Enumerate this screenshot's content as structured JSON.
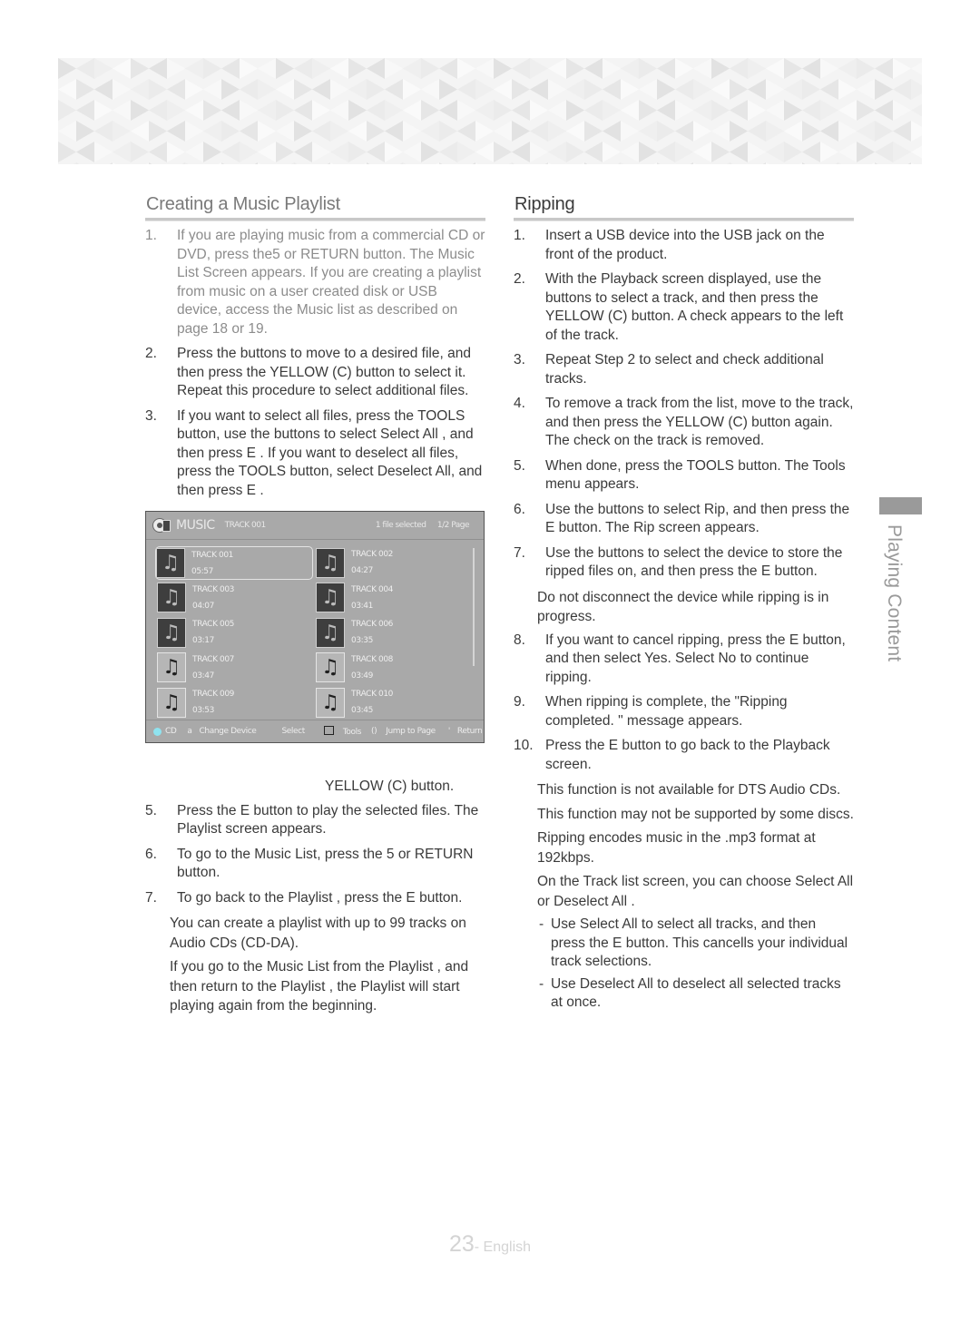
{
  "left": {
    "title": "Creating a Music Playlist",
    "steps": [
      {
        "num": "1.",
        "text": "If you are playing music from a commercial CD or DVD, press the5    or RETURN button. The Music List Screen appears. If you are creating a playlist from music on a user created disk or USB device, access the Music list as described on page 18 or 19."
      },
      {
        "num": "2.",
        "text": "Press the      buttons to move to a desired file, and then press the YELLOW (C) button to select it. Repeat this procedure to select additional files."
      },
      {
        "num": "3.",
        "text": "If you want to select all files, press the TOOLS button, use the    buttons to select    Select All , and then press E   . If you want to deselect all files, press the TOOLS button, select Deselect All, and then press E   ."
      }
    ],
    "orphan_text": "YELLOW (C) button.",
    "steps_after": [
      {
        "num": "5.",
        "text": "Press the E    button to play the selected files. The Playlist  screen appears."
      },
      {
        "num": "6.",
        "text": "To go to the Music List, press the 5    or RETURN button."
      },
      {
        "num": "7.",
        "text": "To go back to the Playlist , press the E    button."
      }
    ],
    "notes": [
      "You can create a playlist with up to 99 tracks on Audio CDs (CD-DA).",
      "If you go to the Music List from the Playlist , and then return to the Playlist , the Playlist  will start playing again from the beginning."
    ]
  },
  "screen": {
    "title": "MUSIC",
    "current_track": "TRACK 001",
    "selected_count": "1 file selected",
    "page": "1/2 Page",
    "tracks": [
      {
        "name": "TRACK 001",
        "time": "05:57",
        "selected": true
      },
      {
        "name": "TRACK 002",
        "time": "04:27"
      },
      {
        "name": "TRACK 003",
        "time": "04:07"
      },
      {
        "name": "TRACK 004",
        "time": "03:41"
      },
      {
        "name": "TRACK 005",
        "time": "03:17"
      },
      {
        "name": "TRACK 006",
        "time": "03:35"
      },
      {
        "name": "TRACK 007",
        "time": "03:47"
      },
      {
        "name": "TRACK 008",
        "time": "03:49"
      },
      {
        "name": "TRACK 009",
        "time": "03:53"
      },
      {
        "name": "TRACK 010",
        "time": "03:45"
      }
    ],
    "footer": {
      "cd": "CD",
      "a_key": "a",
      "change_device": "Change Device",
      "select": "Select",
      "tools": "Tools",
      "jump_key": "()",
      "jump": "Jump to Page",
      "return_key": "'",
      "return": "Return"
    }
  },
  "right": {
    "title": "Ripping",
    "steps": [
      {
        "num": "1.",
        "text": "Insert a USB device into the USB jack on the front of the product."
      },
      {
        "num": "2.",
        "text": "With the Playback screen displayed, use the buttons to select a track, and then press the YELLOW (C) button. A check appears to the left of the track."
      },
      {
        "num": "3.",
        "text": "Repeat Step 2 to select and check additional tracks."
      },
      {
        "num": "4.",
        "text": "To remove a track from the list, move to the track, and then press the YELLOW (C) button again. The check on the track is removed."
      },
      {
        "num": "5.",
        "text": "When done, press the TOOLS button. The Tools  menu appears."
      },
      {
        "num": "6.",
        "text": "Use the    buttons to select    Rip, and then press the E    button. The Rip screen appears."
      },
      {
        "num": "7.",
        "text": "Use the    buttons to select the device to store the ripped files on, and then press the E button."
      }
    ],
    "warning": "Do not disconnect the device while ripping is in progress.",
    "steps_after": [
      {
        "num": "8.",
        "text": "If you want to cancel ripping, press the E button, and then select Yes. Select No to continue ripping."
      },
      {
        "num": "9.",
        "text": "When ripping is complete, the \"Ripping completed. \" message appears."
      },
      {
        "num": "10.",
        "text": "Press the E    button to go back to the Playback screen."
      }
    ],
    "notes": [
      "This function is not available for DTS Audio CDs.",
      "This function may not be supported by some discs.",
      "Ripping encodes music in the .mp3 format at 192kbps.",
      "On the Track list screen, you can choose Select All or Deselect All ."
    ],
    "sub_notes": [
      "Use Select All  to select all tracks, and then press the E    button. This cancells your individual track selections.",
      "Use Deselect All  to deselect all selected tracks at once."
    ]
  },
  "side_tab": "Playing Content",
  "footer": {
    "page_number": "23",
    "language": "- English"
  }
}
